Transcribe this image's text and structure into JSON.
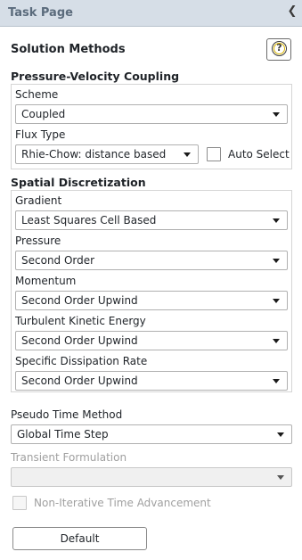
{
  "header": {
    "title": "Task Page",
    "collapse_icon": "chevron-left-icon"
  },
  "page": {
    "title": "Solution Methods",
    "help_icon": "help-icon"
  },
  "pressure_velocity": {
    "title": "Pressure-Velocity Coupling",
    "scheme": {
      "label": "Scheme",
      "value": "Coupled"
    },
    "flux_type": {
      "label": "Flux Type",
      "value": "Rhie-Chow: distance based"
    },
    "auto_select": {
      "label": "Auto Select",
      "checked": false
    }
  },
  "spatial": {
    "title": "Spatial Discretization",
    "gradient": {
      "label": "Gradient",
      "value": "Least Squares Cell Based"
    },
    "pressure": {
      "label": "Pressure",
      "value": "Second Order"
    },
    "momentum": {
      "label": "Momentum",
      "value": "Second Order Upwind"
    },
    "tke": {
      "label": "Turbulent Kinetic Energy",
      "value": "Second Order Upwind"
    },
    "sdr": {
      "label": "Specific Dissipation Rate",
      "value": "Second Order Upwind"
    }
  },
  "pseudo_time": {
    "label": "Pseudo Time Method",
    "value": "Global Time Step"
  },
  "transient": {
    "label": "Transient Formulation",
    "value": ""
  },
  "non_iterative": {
    "label": "Non-Iterative Time Advancement",
    "checked": false
  },
  "default_button": {
    "label": "Default"
  }
}
